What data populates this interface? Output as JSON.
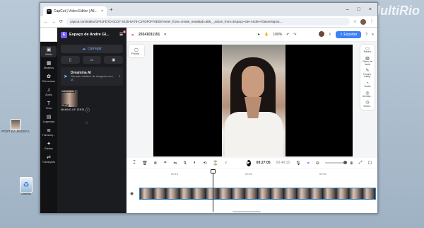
{
  "watermark": "MultiRio",
  "desktop": {
    "icons": [
      {
        "label": "POST DA JESSICA"
      },
      {
        "label": "Lixeira"
      }
    ]
  },
  "browser": {
    "tab_title": "CapCut | Video Editor | All...",
    "tab_favicon": "capcut-icon",
    "url": "capcut.com/editor/1F61FD7D-0CD7-4425-9A79-C2FDF0FF0E05?enter_from=create_new&tab=all&__action_from=Espaço+de+Andre+Glasner&pos..."
  },
  "app": {
    "project_name": "Espaço de Andre Gl...",
    "notification_count": "4",
    "file_name": "20241031151",
    "zoom": "100%",
    "export_label": "Exportar",
    "left_nav": [
      {
        "label": "Mídia",
        "icon": "media-icon"
      },
      {
        "label": "Modelos",
        "icon": "templates-icon"
      },
      {
        "label": "Elementos",
        "icon": "elements-icon"
      },
      {
        "label": "Áudio",
        "icon": "audio-icon"
      },
      {
        "label": "Texto",
        "icon": "text-icon"
      },
      {
        "label": "Legendas",
        "icon": "captions-icon"
      },
      {
        "label": "Transcriç...",
        "icon": "transcript-icon"
      },
      {
        "label": "Efeitos",
        "icon": "effects-icon"
      },
      {
        "label": "Transições",
        "icon": "transitions-icon"
      }
    ],
    "panel": {
      "upload_label": "Carregar",
      "dreamina_title": "Dreamina AI",
      "dreamina_desc": "Gerador intuitivo de imagens com IA",
      "clip_badge": "Adicionado",
      "clip_duration": "00:47",
      "clip_name": "MAKING OF JESSI..."
    },
    "proportion_label": "Propor...",
    "right_nav": [
      {
        "label": "Básico",
        "icon": "basic-icon"
      },
      {
        "label": "Plano de fundo",
        "icon": "background-icon"
      },
      {
        "label": "Ferram. intelig.",
        "icon": "smart-tools-icon"
      },
      {
        "label": "Áudio",
        "icon": "audio-icon"
      },
      {
        "label": "Animaç...",
        "icon": "animation-icon"
      },
      {
        "label": "Veloci...",
        "icon": "speed-icon"
      }
    ],
    "playback": {
      "current_time": "00:27:05",
      "total_time": "00:49:15"
    },
    "ruler_labels": [
      "00:10",
      "00:20",
      "00:30",
      "00:40"
    ],
    "timeline_frames": 18,
    "playhead_fraction": 0.31
  }
}
